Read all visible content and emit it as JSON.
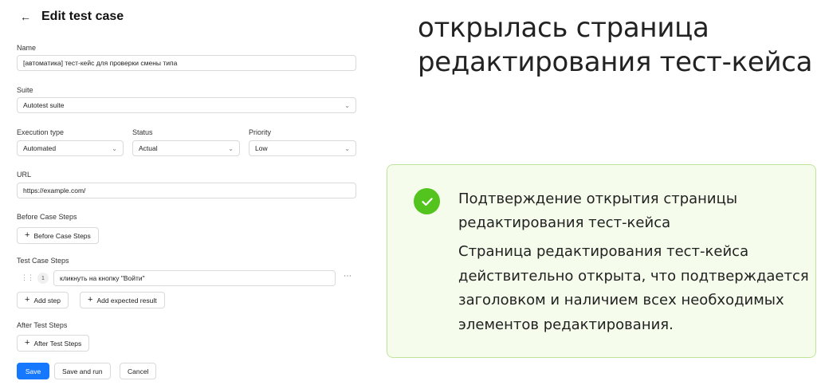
{
  "header": {
    "back_icon": "arrow-left-icon",
    "title": "Edit test case"
  },
  "form": {
    "name": {
      "label": "Name",
      "value": "[автоматика] тест-кейс для проверки смены типа"
    },
    "suite": {
      "label": "Suite",
      "value": "Autotest suite"
    },
    "execution_type": {
      "label": "Execution type",
      "value": "Automated"
    },
    "status": {
      "label": "Status",
      "value": "Actual"
    },
    "priority": {
      "label": "Priority",
      "value": "Low"
    },
    "url": {
      "label": "URL",
      "value": "https://example.com/"
    },
    "before_case_steps": {
      "label": "Before Case Steps",
      "add_label": "Before Case Steps"
    },
    "test_case_steps": {
      "label": "Test Case Steps",
      "steps": [
        {
          "number": "1",
          "text": "кликнуть на кнопку \"Войти\""
        }
      ],
      "add_step_label": "Add step",
      "add_expected_label": "Add expected result"
    },
    "after_test_steps": {
      "label": "After Test Steps",
      "add_label": "After Test Steps"
    },
    "actions": {
      "save": "Save",
      "save_and_run": "Save and run",
      "cancel": "Cancel"
    }
  },
  "annotation": {
    "heading": "открылась страница редактирования тест-кейса",
    "card": {
      "icon": "check-circle-icon",
      "title": "Подтверждение открытия страницы редактирования тест-кейса",
      "text": "Страница редактирования тест-кейса действительно открыта, что подтверждается заголовком и наличием всех необходимых элементов редактирования."
    },
    "colors": {
      "card_bg": "#f5fcec",
      "card_border": "#bfe59a",
      "check": "#53c41d",
      "primary": "#1677ff"
    }
  }
}
